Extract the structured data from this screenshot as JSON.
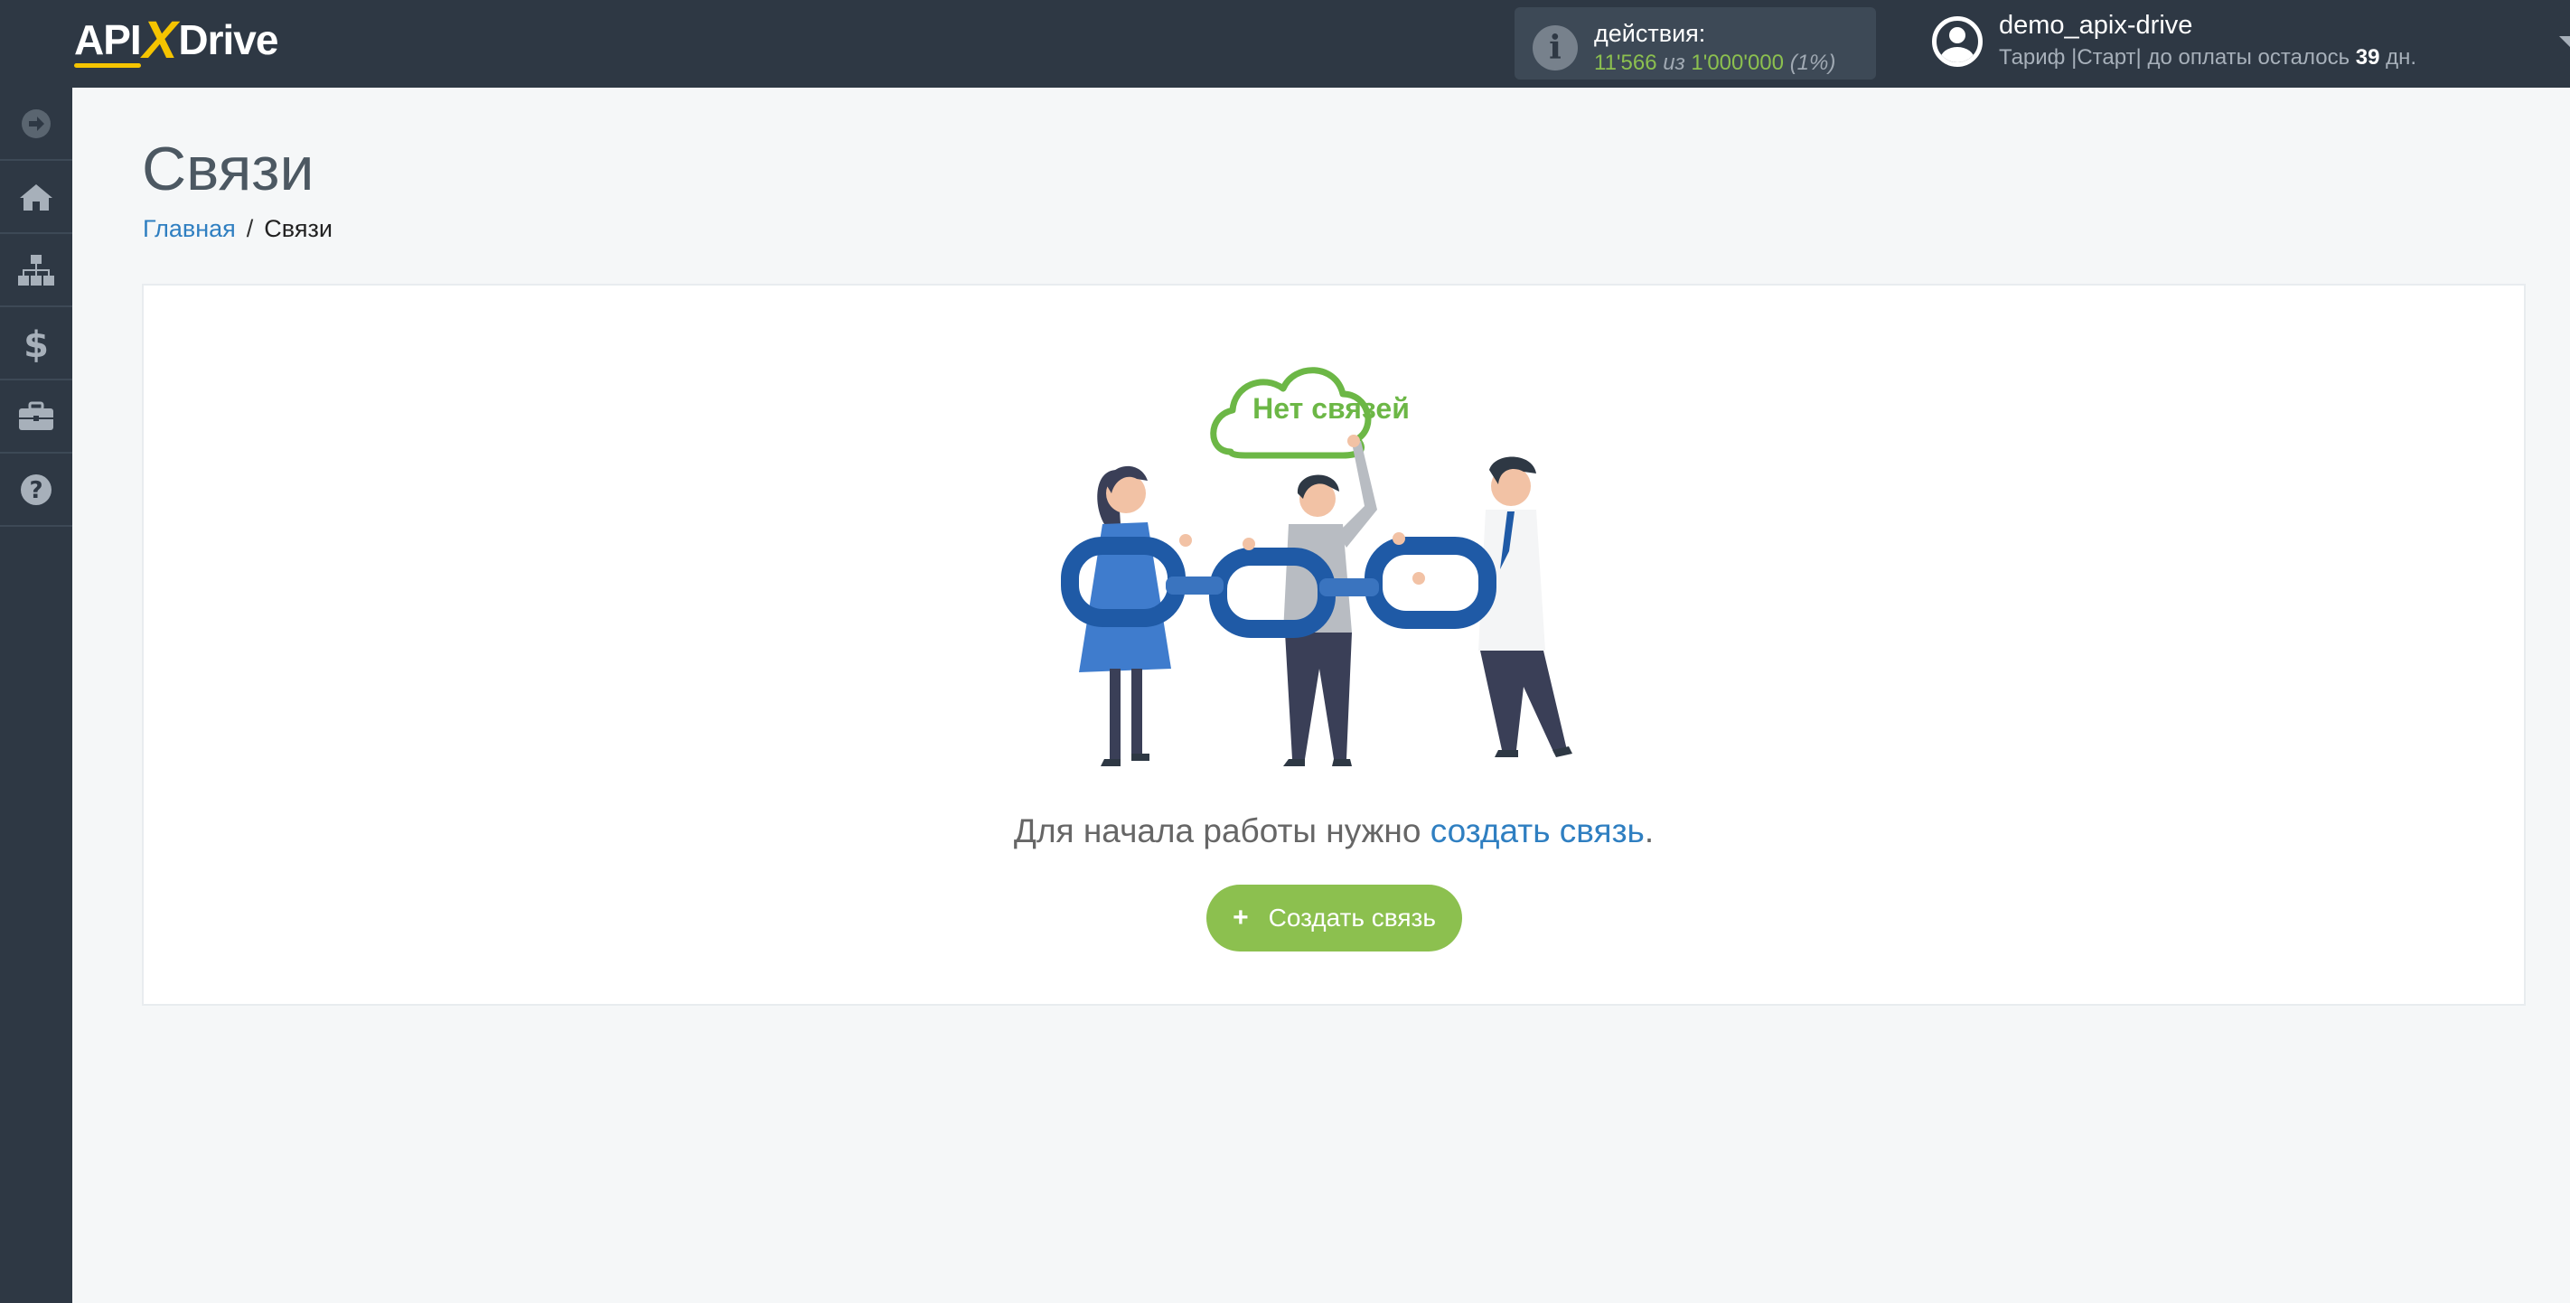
{
  "header": {
    "logo_api": "API",
    "logo_x": "X",
    "logo_drive": "Drive",
    "actions": {
      "label": "действия:",
      "used": "11'566",
      "of_word": "из",
      "total": "1'000'000",
      "percent": "(1%)"
    },
    "user": {
      "name": "demo_apix-drive",
      "plan_prefix": "Тариф |Старт| до оплаты осталось",
      "days": "39",
      "days_suffix": "дн."
    }
  },
  "sidebar": {
    "items": [
      {
        "icon": "arrow-right-circle-icon"
      },
      {
        "icon": "home-icon"
      },
      {
        "icon": "sitemap-icon"
      },
      {
        "icon": "dollar-icon"
      },
      {
        "icon": "briefcase-icon"
      },
      {
        "icon": "help-circle-icon"
      }
    ]
  },
  "page": {
    "title": "Связи",
    "breadcrumb": {
      "home": "Главная",
      "separator": "/",
      "current": "Связи"
    }
  },
  "empty_state": {
    "cloud_text": "Нет связей",
    "prompt_text": "Для начала работы нужно",
    "prompt_link": "создать связь",
    "prompt_end": ".",
    "button_icon": "+",
    "button_label": "Создать связь"
  },
  "colors": {
    "topbar": "#2e3844",
    "accent_green": "#8cc04f",
    "link_blue": "#2f7fc1",
    "logo_yellow": "#f5c400",
    "chain_blue": "#1f5aa6"
  }
}
